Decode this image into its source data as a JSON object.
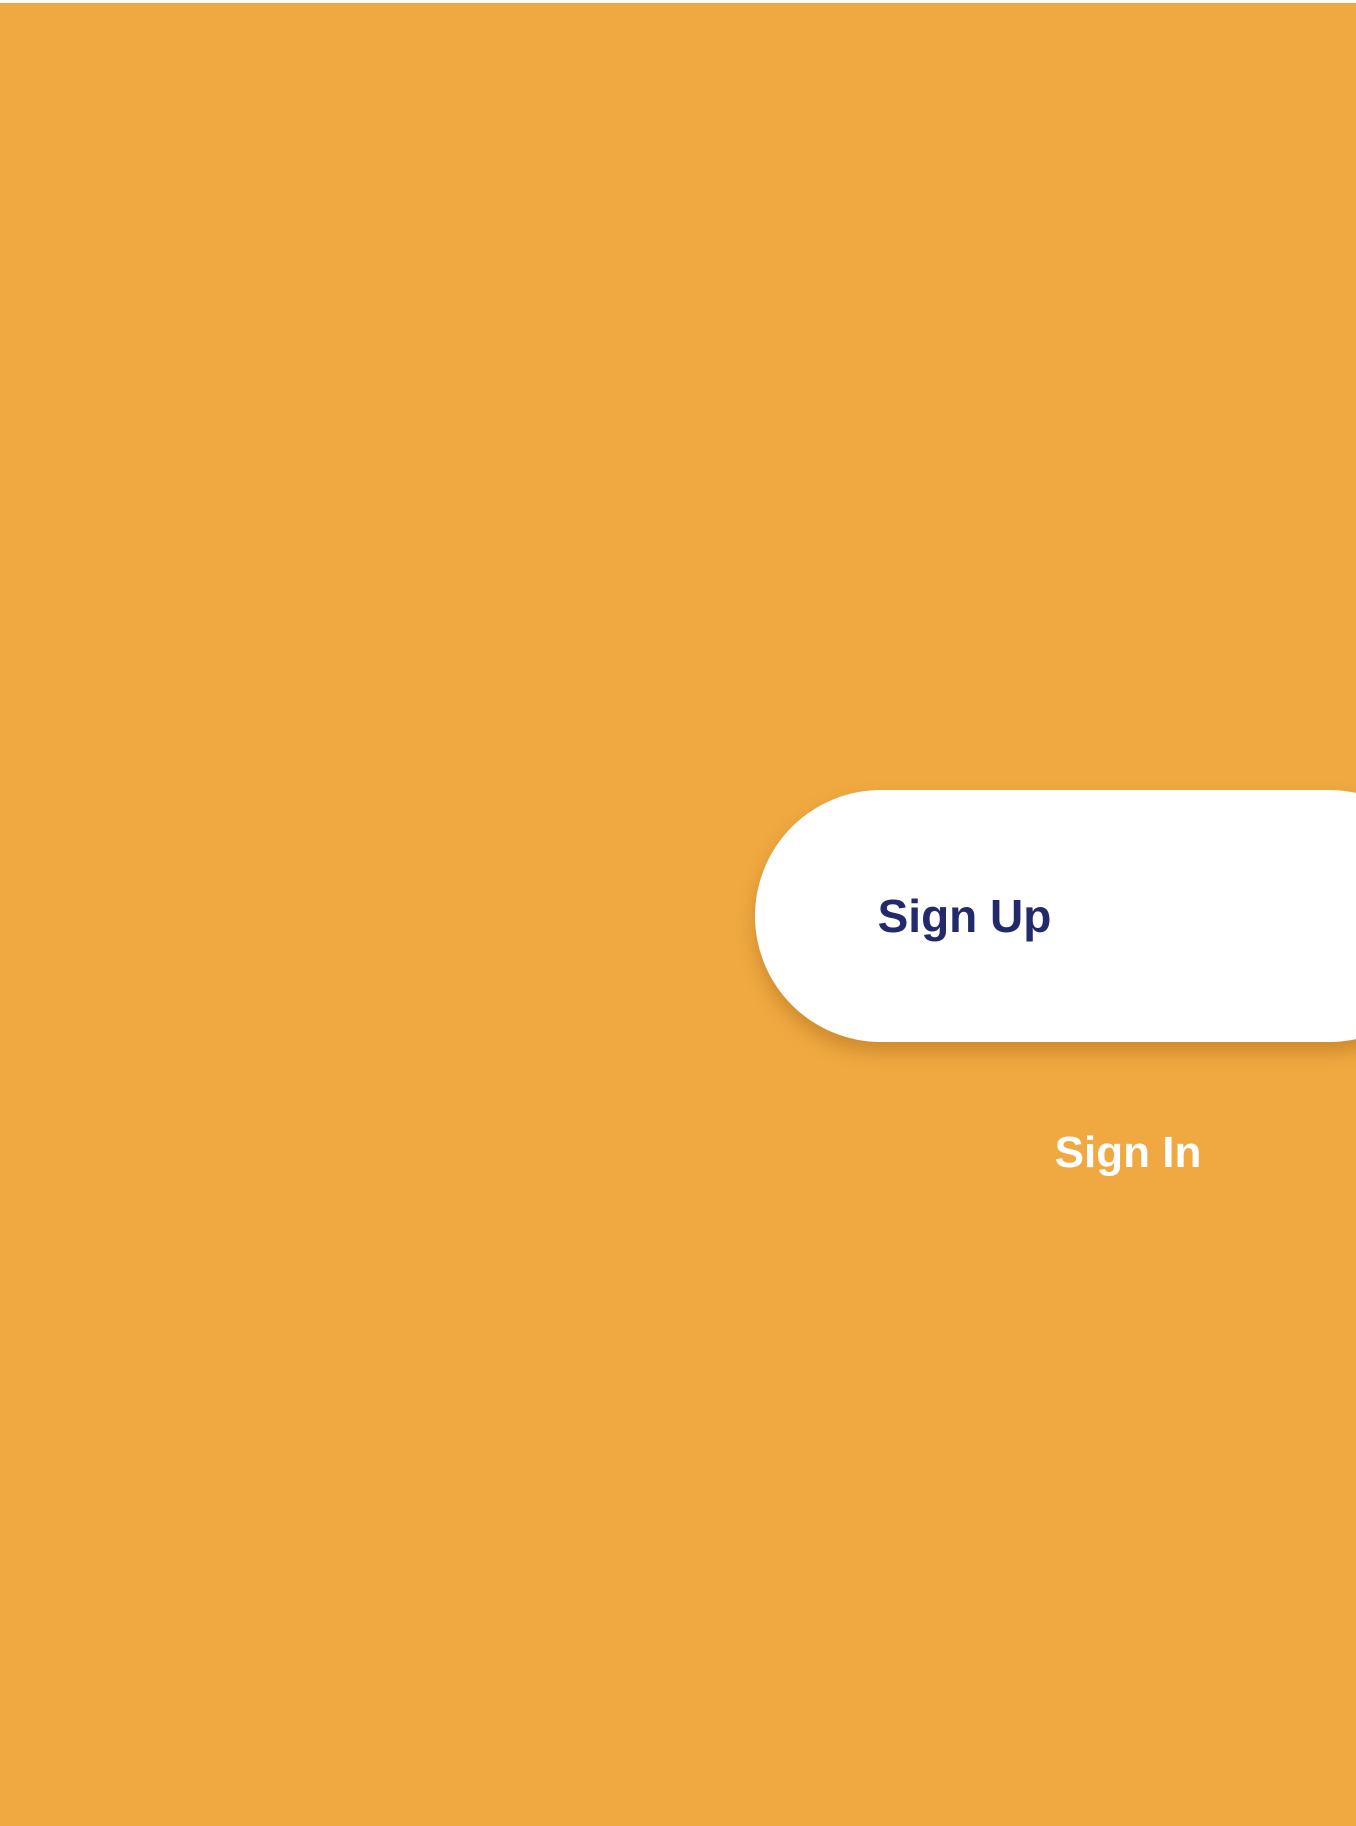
{
  "colors": {
    "background": "#F0A941",
    "button_background": "#FFFFFF",
    "button_text": "#232A6B",
    "link_text": "#FFFFFF"
  },
  "actions": {
    "sign_up_label": "Sign Up",
    "sign_in_label": "Sign In"
  }
}
